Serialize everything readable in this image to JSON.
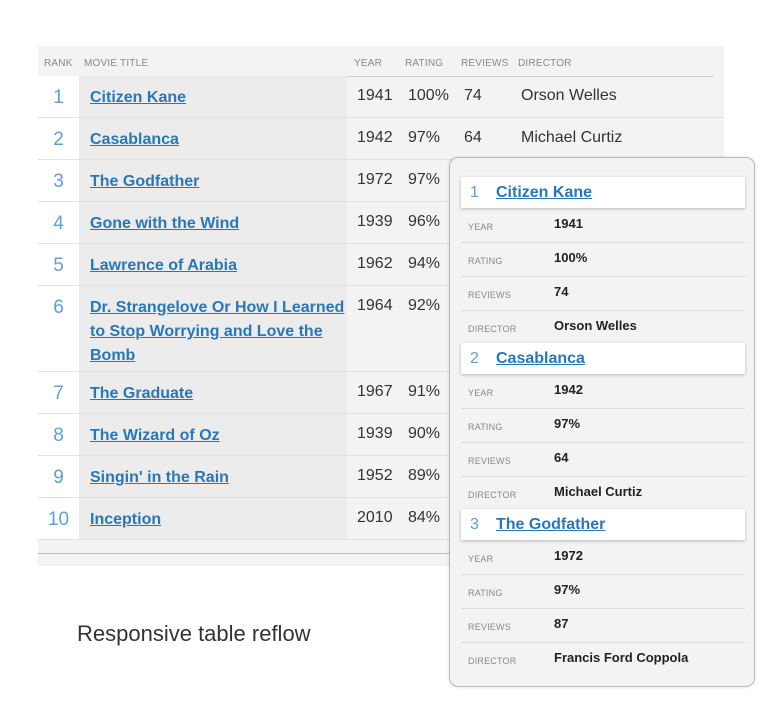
{
  "table": {
    "headers": {
      "rank": "RANK",
      "title": "MOVIE TITLE",
      "year": "YEAR",
      "rating": "RATING",
      "reviews": "REVIEWS",
      "director": "DIRECTOR"
    },
    "rows": [
      {
        "rank": "1",
        "title": "Citizen Kane",
        "year": "1941",
        "rating": "100%",
        "reviews": "74",
        "director": "Orson Welles"
      },
      {
        "rank": "2",
        "title": "Casablanca",
        "year": "1942",
        "rating": "97%",
        "reviews": "64",
        "director": "Michael Curtiz"
      },
      {
        "rank": "3",
        "title": "The Godfather",
        "year": "1972",
        "rating": "97%"
      },
      {
        "rank": "4",
        "title": "Gone with the Wind",
        "year": "1939",
        "rating": "96%"
      },
      {
        "rank": "5",
        "title": "Lawrence of Arabia",
        "year": "1962",
        "rating": "94%"
      },
      {
        "rank": "6",
        "title": "Dr. Strangelove Or How I Learned to Stop Worrying and Love the Bomb",
        "year": "1964",
        "rating": "92%"
      },
      {
        "rank": "7",
        "title": "The Graduate",
        "year": "1967",
        "rating": "91%"
      },
      {
        "rank": "8",
        "title": "The Wizard of Oz",
        "year": "1939",
        "rating": "90%"
      },
      {
        "rank": "9",
        "title": "Singin' in the Rain",
        "year": "1952",
        "rating": "89%"
      },
      {
        "rank": "10",
        "title": "Inception",
        "year": "2010",
        "rating": "84%"
      }
    ]
  },
  "caption": "Responsive table reflow",
  "cards": {
    "labels": {
      "year": "YEAR",
      "rating": "RATING",
      "reviews": "REVIEWS",
      "director": "DIRECTOR"
    },
    "items": [
      {
        "rank": "1",
        "title": "Citizen Kane",
        "year": "1941",
        "rating": "100%",
        "reviews": "74",
        "director": "Orson Welles"
      },
      {
        "rank": "2",
        "title": "Casablanca",
        "year": "1942",
        "rating": "97%",
        "reviews": "64",
        "director": "Michael Curtiz"
      },
      {
        "rank": "3",
        "title": "The Godfather",
        "year": "1972",
        "rating": "97%",
        "reviews": "87",
        "director": "Francis Ford Coppola"
      }
    ]
  },
  "colors": {
    "link": "#2877b8",
    "rank": "#5fa0d8"
  }
}
